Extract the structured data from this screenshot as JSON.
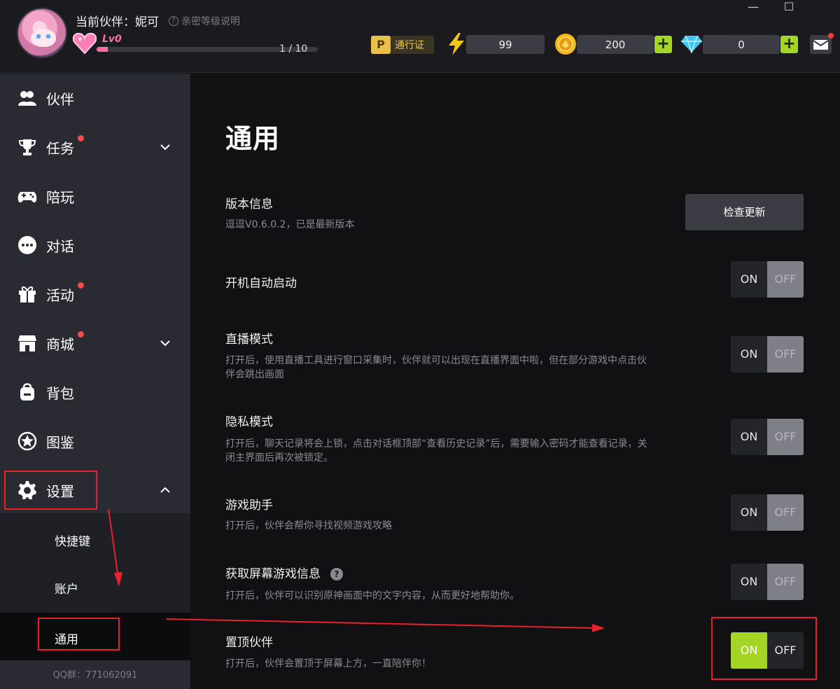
{
  "header": {
    "partner_label": "当前伙伴：妮可",
    "level_help": "亲密等级说明",
    "level": "Lv0",
    "level_progress": 0.05,
    "level_count": "1 / 10",
    "pass_label": "通行证",
    "pass_icon_text": "P",
    "energy": "99",
    "coins": "200",
    "diamonds": "0"
  },
  "window": {
    "minimize": "—",
    "maximize": "☐"
  },
  "sidebar": {
    "items": [
      {
        "label": "伙伴"
      },
      {
        "label": "任务"
      },
      {
        "label": "陪玩"
      },
      {
        "label": "对话"
      },
      {
        "label": "活动"
      },
      {
        "label": "商城"
      },
      {
        "label": "背包"
      },
      {
        "label": "图鉴"
      },
      {
        "label": "设置"
      }
    ],
    "sub_items": [
      {
        "label": "快捷键"
      },
      {
        "label": "账户"
      },
      {
        "label": "通用"
      }
    ],
    "qq": "QQ群：771062091"
  },
  "main": {
    "title": "通用",
    "version": {
      "title": "版本信息",
      "desc": "逗逗V0.6.0.2，已是最新版本",
      "button": "检查更新"
    },
    "toggle_on": "ON",
    "toggle_off": "OFF",
    "settings": [
      {
        "title": "开机自动启动",
        "desc": "",
        "state": "off"
      },
      {
        "title": "直播模式",
        "desc": "打开后，使用直播工具进行窗口采集时，伙伴就可以出现在直播界面中啦，但在部分游戏中点击伙伴会跳出画面",
        "state": "off"
      },
      {
        "title": "隐私模式",
        "desc": "打开后，聊天记录将会上锁，点击对话框顶部“查看历史记录”后，需要输入密码才能查看记录，关闭主界面后再次被锁定。",
        "state": "off"
      },
      {
        "title": "游戏助手",
        "desc": "打开后，伙伴会帮你寻找视频游戏攻略",
        "state": "off"
      },
      {
        "title": "获取屏幕游戏信息",
        "desc": "打开后，伙伴可以识别原神画面中的文字内容，从而更好地帮助你。",
        "state": "off"
      },
      {
        "title": "置顶伙伴",
        "desc": "打开后，伙伴会置顶于屏幕上方，一直陪伴你！",
        "state": "on"
      }
    ],
    "help_icon": "?"
  },
  "colors": {
    "accent": "#a4d424",
    "annotation": "#e8212a",
    "badge": "#ff4a4a"
  }
}
